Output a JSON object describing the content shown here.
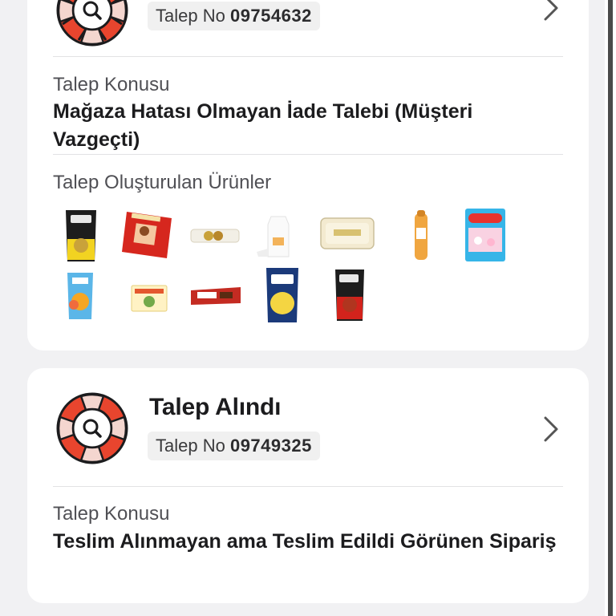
{
  "colors": {
    "accent_red": "#e8452e",
    "card_bg": "#ffffff",
    "page_bg": "#f1f1f3"
  },
  "requests": [
    {
      "status_title": "",
      "talep_no_prefix": "Talep No ",
      "talep_no": "09754632",
      "subject_label": "Talep Konusu",
      "subject_value": "Mağaza Hatası Olmayan İade Talebi (Müşteri Vazgeçti)",
      "products_label": "Talep Oluşturulan Ürünler",
      "products": [
        {
          "icon": "snack-bag-yellow-icon"
        },
        {
          "icon": "chocolate-box-red-icon"
        },
        {
          "icon": "wafer-bar-icon"
        },
        {
          "icon": "milk-carton-icon"
        },
        {
          "icon": "tub-container-icon"
        },
        {
          "icon": "bread-bag-icon"
        },
        {
          "icon": "candy-bag-haribo-icon"
        },
        {
          "icon": "juice-pouch-icon"
        },
        {
          "icon": "small-snack-pack-icon"
        },
        {
          "icon": "chocolate-bar-red-icon"
        },
        {
          "icon": "chips-bag-blue-icon"
        },
        {
          "icon": "snack-bag-red-icon"
        }
      ]
    },
    {
      "status_title": "Talep Alındı",
      "talep_no_prefix": "Talep No ",
      "talep_no": "09749325",
      "subject_label": "Talep Konusu",
      "subject_value": "Teslim Alınmayan ama Teslim Edildi Görünen Sipariş"
    }
  ],
  "icons": {
    "support": "lifebuoy-search-icon",
    "chevron": "chevron-right-icon"
  }
}
